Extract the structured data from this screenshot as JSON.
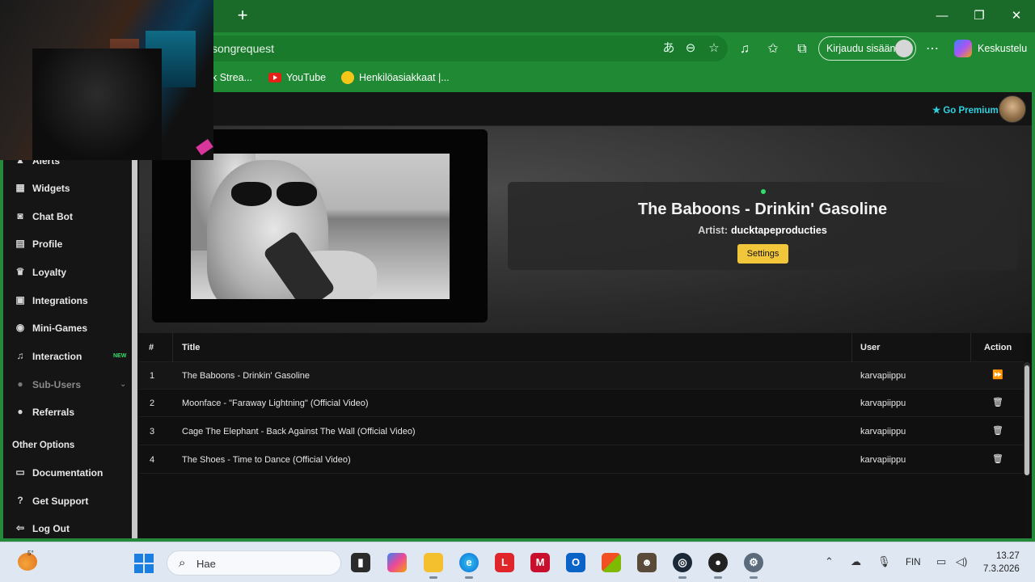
{
  "browser": {
    "url_fragment": "songrequest",
    "signin_label": "Kirjaudu sisään",
    "copilot_label": "Keskustelu",
    "bookmarks": [
      {
        "label": "k Strea..."
      },
      {
        "label": "YouTube"
      },
      {
        "label": "Henkilöasiakkaat |..."
      }
    ]
  },
  "header": {
    "premium_label": "Go Premium"
  },
  "sidebar": {
    "items": [
      {
        "label": "Alerts",
        "icon": "bell-icon"
      },
      {
        "label": "Widgets",
        "icon": "grid-icon"
      },
      {
        "label": "Chat Bot",
        "icon": "robot-icon"
      },
      {
        "label": "Profile",
        "icon": "id-card-icon"
      },
      {
        "label": "Loyalty",
        "icon": "trophy-icon"
      },
      {
        "label": "Integrations",
        "icon": "plug-icon"
      },
      {
        "label": "Mini-Games",
        "icon": "gamepad-icon"
      },
      {
        "label": "Interaction",
        "icon": "music-note-icon",
        "badge": "NEW"
      },
      {
        "label": "Sub-Users",
        "icon": "users-icon"
      },
      {
        "label": "Referrals",
        "icon": "people-icon"
      }
    ],
    "section_other": "Other Options",
    "other_items": [
      {
        "label": "Documentation",
        "icon": "doc-icon"
      },
      {
        "label": "Get Support",
        "icon": "help-icon"
      },
      {
        "label": "Log Out",
        "icon": "logout-icon"
      }
    ]
  },
  "now_playing": {
    "title": "The Baboons - Drinkin' Gasoline",
    "artist_label": "Artist:",
    "artist": "ducktapeproducties",
    "settings_label": "Settings"
  },
  "queue": {
    "headers": {
      "num": "#",
      "title": "Title",
      "user": "User",
      "action": "Action"
    },
    "rows": [
      {
        "num": "1",
        "title": "The Baboons - Drinkin' Gasoline",
        "user": "karvapiippu",
        "action": "skip-icon"
      },
      {
        "num": "2",
        "title": "Moonface - \"Faraway Lightning\" (Official Video)",
        "user": "karvapiippu",
        "action": "trash-icon"
      },
      {
        "num": "3",
        "title": "Cage The Elephant - Back Against The Wall (Official Video)",
        "user": "karvapiippu",
        "action": "trash-icon"
      },
      {
        "num": "4",
        "title": "The Shoes - Time to Dance (Official Video)",
        "user": "karvapiippu",
        "action": "trash-icon"
      }
    ]
  },
  "taskbar": {
    "weather_temp": "5°",
    "search_placeholder": "Hae",
    "language": "FIN",
    "time": "13.27",
    "date": "7.3.2026"
  },
  "colors": {
    "browser_green": "#1f8a33",
    "accent_cyan": "#2fd1e0",
    "settings_yellow": "#f2c63a",
    "new_badge_green": "#35e06a"
  }
}
